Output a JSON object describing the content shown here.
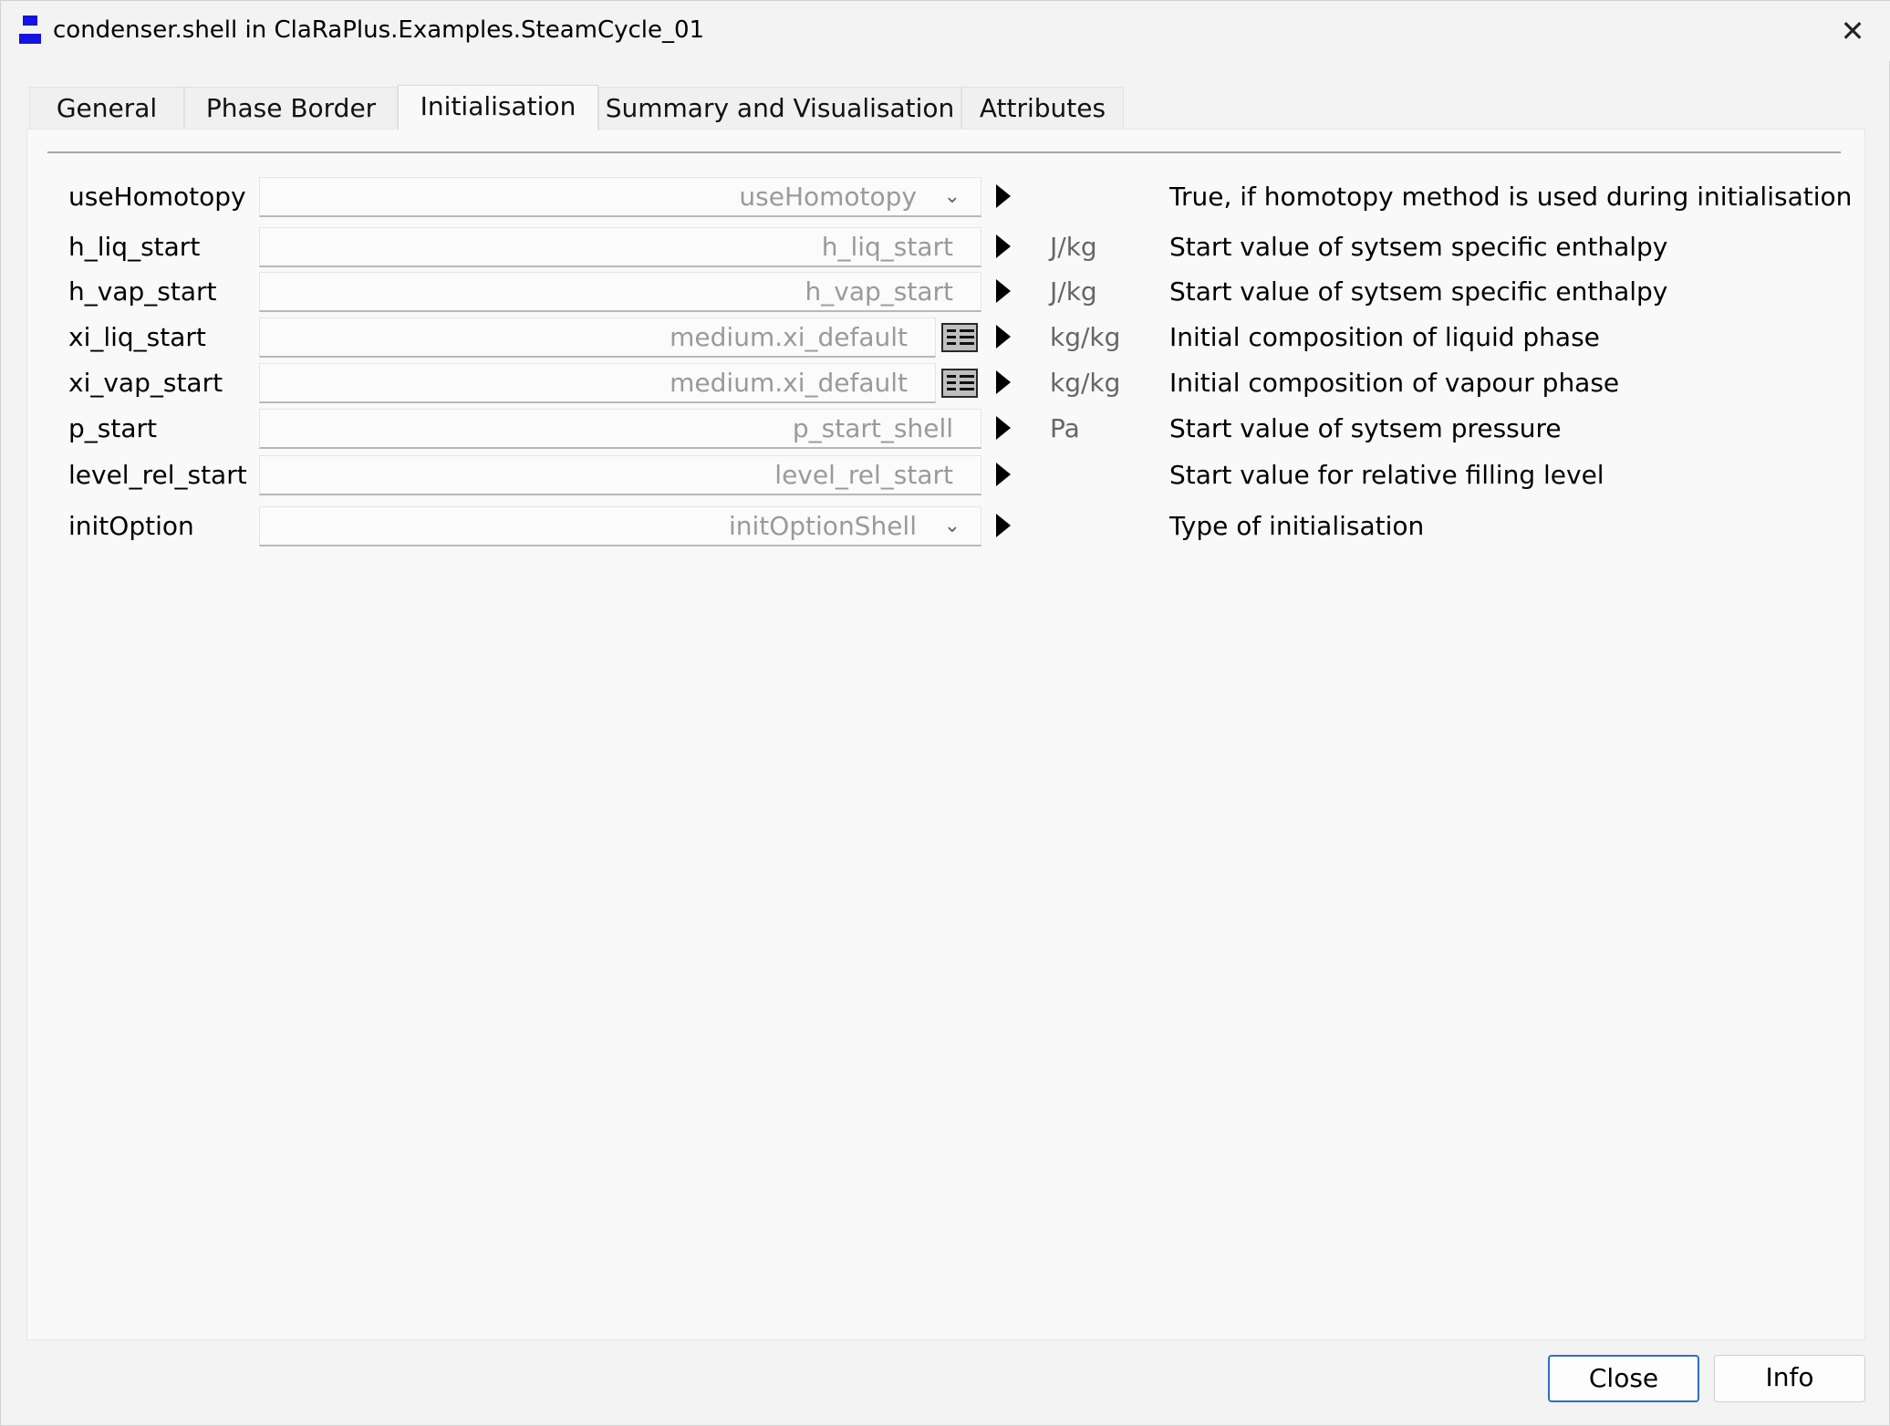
{
  "window": {
    "title": "condenser.shell in ClaRaPlus.Examples.SteamCycle_01",
    "close_glyph": "✕"
  },
  "tabs": [
    {
      "label": "General",
      "active": false
    },
    {
      "label": "Phase Border",
      "active": false
    },
    {
      "label": "Initialisation",
      "active": true
    },
    {
      "label": "Summary and Visualisation",
      "active": false
    },
    {
      "label": "Attributes",
      "active": false
    }
  ],
  "params": [
    {
      "name": "useHomotopy",
      "value": "useHomotopy",
      "control": "dropdown",
      "unit": "",
      "description": "True, if homotopy method is used during initialisation"
    },
    {
      "name": "h_liq_start",
      "value": "h_liq_start",
      "control": "text",
      "unit": "J/kg",
      "description": "Start value of sytsem specific enthalpy"
    },
    {
      "name": "h_vap_start",
      "value": "h_vap_start",
      "control": "text",
      "unit": "J/kg",
      "description": "Start value of sytsem specific enthalpy"
    },
    {
      "name": "xi_liq_start",
      "value": "medium.xi_default",
      "control": "matrix",
      "unit": "kg/kg",
      "description": "Initial composition of liquid phase"
    },
    {
      "name": "xi_vap_start",
      "value": "medium.xi_default",
      "control": "matrix",
      "unit": "kg/kg",
      "description": "Initial composition of vapour phase"
    },
    {
      "name": "p_start",
      "value": "p_start_shell",
      "control": "text",
      "unit": "Pa",
      "description": "Start value of sytsem pressure"
    },
    {
      "name": "level_rel_start",
      "value": "level_rel_start",
      "control": "text",
      "unit": "",
      "description": "Start value for relative filling level"
    },
    {
      "name": "initOption",
      "value": "initOptionShell",
      "control": "dropdown",
      "unit": "",
      "description": "Type of initialisation"
    }
  ],
  "buttons": {
    "close_label": "Close",
    "info_label": "Info"
  },
  "icons": {
    "app": "claraplus-model-icon",
    "dropdown": "chevron-down-icon",
    "matrix": "matrix-editor-icon",
    "menu": "triangle-right-icon"
  },
  "colors": {
    "app_icon_blue": "#1414e0",
    "primary_button_border": "#2f6fc4"
  }
}
